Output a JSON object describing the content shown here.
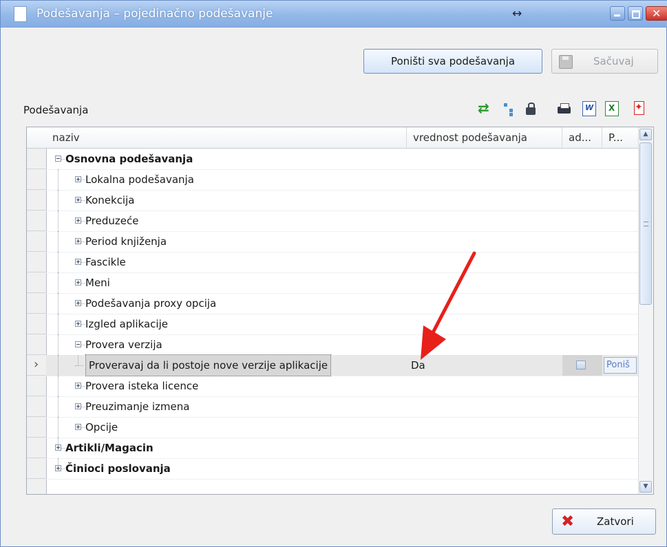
{
  "window": {
    "title": "Podešavanja – pojedinačno podešavanje",
    "resize_glyph": "↔"
  },
  "toolbar": {
    "reset_all_label": "Poništi sva podešavanja",
    "save_label": "Sačuvaj"
  },
  "settings_section": {
    "label": "Podešavanja",
    "icons": [
      "refresh-icon",
      "tree-icon",
      "lock-icon",
      "print-icon",
      "word-export-icon",
      "excel-export-icon",
      "pdf-export-icon"
    ]
  },
  "grid": {
    "columns": [
      "naziv",
      "vrednost podešavanja",
      "ad...",
      "P..."
    ],
    "rows": [
      {
        "label": "Osnovna podešavanja",
        "level": 0,
        "expanded": true,
        "bold": true
      },
      {
        "label": "Lokalna podešavanja",
        "level": 1,
        "expanded": false
      },
      {
        "label": "Konekcija",
        "level": 1,
        "expanded": false
      },
      {
        "label": "Preduzeće",
        "level": 1,
        "expanded": false
      },
      {
        "label": "Period knjiženja",
        "level": 1,
        "expanded": false
      },
      {
        "label": "Fascikle",
        "level": 1,
        "expanded": false
      },
      {
        "label": "Meni",
        "level": 1,
        "expanded": false
      },
      {
        "label": "Podešavanja proxy opcija",
        "level": 1,
        "expanded": false
      },
      {
        "label": "Izgled aplikacije",
        "level": 1,
        "expanded": false
      },
      {
        "label": "Provera verzija",
        "level": 1,
        "expanded": true
      },
      {
        "label": "Proveravaj da li postoje nove verzije aplikacije",
        "level": 2,
        "selected": true,
        "value": "Da",
        "button": "Poniš"
      },
      {
        "label": "Provera isteka licence",
        "level": 1,
        "expanded": false
      },
      {
        "label": "Preuzimanje izmena",
        "level": 1,
        "expanded": false
      },
      {
        "label": "Opcije",
        "level": 1,
        "expanded": false
      },
      {
        "label": "Artikli/Magacin",
        "level": 0,
        "expanded": false,
        "bold": true
      },
      {
        "label": "Činioci poslovanja",
        "level": 0,
        "expanded": false,
        "bold": true
      }
    ]
  },
  "footer": {
    "close_label": "Zatvori"
  },
  "colors": {
    "titlebar": "#93b8e8",
    "annotation_arrow": "#e8201a",
    "selected_row": "#e8e8e8"
  }
}
